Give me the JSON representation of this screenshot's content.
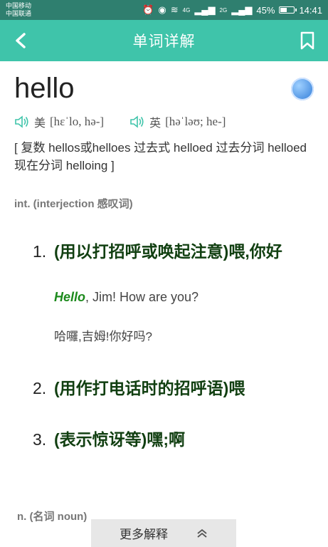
{
  "status": {
    "carrier1": "中国移动",
    "carrier2": "中国联通",
    "net1": "4G",
    "net2": "2G",
    "battery": "45%",
    "battery_level": 0.45,
    "time": "14:41"
  },
  "appbar": {
    "title": "单词详解"
  },
  "word": "hello",
  "pron": {
    "us_region": "美",
    "us_ipa": "[hɛˈlo, hə-]",
    "uk_region": "英",
    "uk_ipa": "[həˈləʊ; he-]"
  },
  "forms": "[ 复数 hellos或helloes 过去式 helloed 过去分词 helloed 现在分词 helloing ]",
  "pos1": "int. (interjection 感叹词)",
  "definitions": [
    {
      "num": "1.",
      "text": "(用以打招呼或唤起注意)喂,你好",
      "example_hl": "Hello",
      "example_rest": ", Jim! How are you?",
      "translation": "哈囉,吉姆!你好吗?"
    },
    {
      "num": "2.",
      "text": "(用作打电话时的招呼语)喂"
    },
    {
      "num": "3.",
      "text": "(表示惊讶等)嘿;啊"
    }
  ],
  "pos2": "n. (名词 noun)",
  "more_label": "更多解释"
}
